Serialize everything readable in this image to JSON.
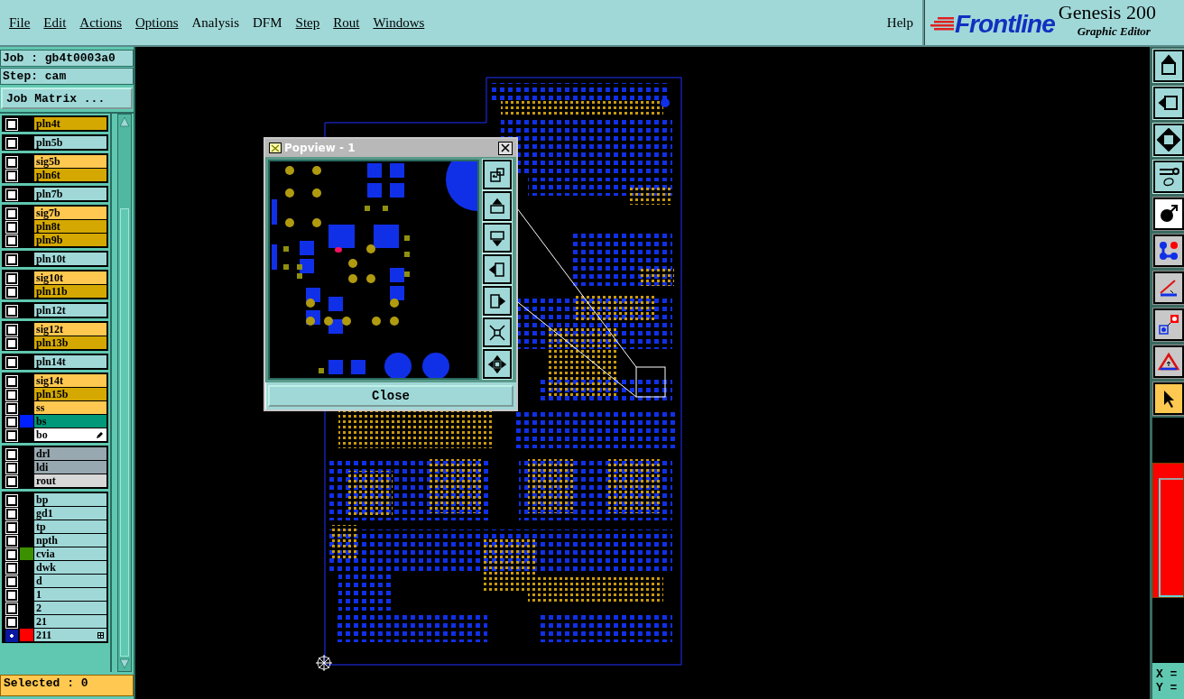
{
  "menu": [
    {
      "label": "File",
      "underlined": true
    },
    {
      "label": "Edit",
      "underlined": true
    },
    {
      "label": "Actions",
      "underlined": true
    },
    {
      "label": "Options",
      "underlined": true
    },
    {
      "label": "Analysis",
      "underlined": false
    },
    {
      "label": "DFM",
      "underlined": false
    },
    {
      "label": "Step",
      "underlined": true
    },
    {
      "label": "Rout",
      "underlined": true
    },
    {
      "label": "Windows",
      "underlined": true
    }
  ],
  "help": {
    "label": "Help"
  },
  "brand": {
    "logo": "Frontline",
    "product": "Genesis 200",
    "subtitle": "Graphic Editor"
  },
  "job_line": "Job : gb4t0003a0",
  "step_line": "Step: cam",
  "job_matrix_button": "Job Matrix ...",
  "layer_groups": [
    {
      "layers": [
        {
          "name": "pln4t",
          "color": "#d4a800",
          "kind": "normal",
          "selected": false
        }
      ]
    },
    {
      "layers": [
        {
          "name": "pln5b",
          "color": "#a0d8d8",
          "kind": "normal",
          "selected": false
        }
      ]
    },
    {
      "layers": [
        {
          "name": "sig5b",
          "color": "#ffc850",
          "kind": "normal",
          "selected": false
        },
        {
          "name": "pln6t",
          "color": "#d4a800",
          "kind": "normal",
          "selected": false
        }
      ]
    },
    {
      "layers": [
        {
          "name": "pln7b",
          "color": "#a0d8d8",
          "kind": "normal",
          "selected": false
        }
      ]
    },
    {
      "layers": [
        {
          "name": "sig7b",
          "color": "#ffc850",
          "kind": "normal",
          "selected": false
        },
        {
          "name": "pln8t",
          "color": "#d4a800",
          "kind": "normal",
          "selected": false
        },
        {
          "name": "pln9b",
          "color": "#d4a800",
          "kind": "normal",
          "selected": false
        }
      ]
    },
    {
      "layers": [
        {
          "name": "pln10t",
          "color": "#a0d8d8",
          "kind": "normal",
          "selected": false
        }
      ]
    },
    {
      "layers": [
        {
          "name": "sig10t",
          "color": "#ffc850",
          "kind": "normal",
          "selected": false
        },
        {
          "name": "pln11b",
          "color": "#d4a800",
          "kind": "normal",
          "selected": false
        }
      ]
    },
    {
      "layers": [
        {
          "name": "pln12t",
          "color": "#a0d8d8",
          "kind": "normal",
          "selected": false
        }
      ]
    },
    {
      "layers": [
        {
          "name": "sig12t",
          "color": "#ffc850",
          "kind": "normal",
          "selected": false
        },
        {
          "name": "pln13b",
          "color": "#d4a800",
          "kind": "normal",
          "selected": false
        }
      ]
    },
    {
      "layers": [
        {
          "name": "pln14t",
          "color": "#a0d8d8",
          "kind": "normal",
          "selected": false
        }
      ]
    },
    {
      "layers": [
        {
          "name": "sig14t",
          "color": "#ffc850",
          "kind": "normal",
          "selected": false
        },
        {
          "name": "pln15b",
          "color": "#d4a800",
          "kind": "normal",
          "selected": false
        },
        {
          "name": "ss",
          "color": "#ffc850",
          "kind": "normal",
          "selected": false
        },
        {
          "name": "bs",
          "color": "#009878",
          "swatch": {
            "color": "#0020ff"
          },
          "kind": "normal",
          "selected": false
        },
        {
          "name": "bo",
          "color": "#ffffff",
          "kind": "work",
          "selected": false
        }
      ]
    },
    {
      "layers": [
        {
          "name": "drl",
          "color": "#98a8b0",
          "kind": "normal",
          "selected": false
        },
        {
          "name": "ldi",
          "color": "#98a8b0",
          "kind": "normal",
          "selected": false
        },
        {
          "name": "rout",
          "color": "#d8d8d8",
          "kind": "normal",
          "selected": false
        }
      ]
    },
    {
      "layers": [
        {
          "name": "bp",
          "color": "#a0d8d8",
          "kind": "normal",
          "selected": false
        },
        {
          "name": "gd1",
          "color": "#a0d8d8",
          "kind": "normal",
          "selected": false
        },
        {
          "name": "tp",
          "color": "#a0d8d8",
          "kind": "normal",
          "selected": false
        },
        {
          "name": "npth",
          "color": "#a0d8d8",
          "kind": "normal",
          "selected": false
        },
        {
          "name": "cvia",
          "color": "#a0d8d8",
          "swatch": {
            "color": "#3c9000"
          },
          "kind": "normal",
          "selected": false
        },
        {
          "name": "dwk",
          "color": "#a0d8d8",
          "kind": "normal",
          "selected": false
        },
        {
          "name": "d",
          "color": "#a0d8d8",
          "kind": "normal",
          "selected": false
        },
        {
          "name": "1",
          "color": "#a0d8d8",
          "kind": "normal",
          "selected": false
        },
        {
          "name": "2",
          "color": "#a0d8d8",
          "kind": "normal",
          "selected": false
        },
        {
          "name": "21",
          "color": "#a0d8d8",
          "kind": "normal",
          "selected": false
        },
        {
          "name": "211",
          "color": "#a0d8d8",
          "swatch": {
            "color": "#ff0000"
          },
          "kind": "affected",
          "selected": true
        }
      ]
    }
  ],
  "selected_status": "Selected : 0",
  "popview": {
    "title": "Popview - 1",
    "close_button": "Close"
  },
  "tools": [
    {
      "kind": "view",
      "selected": false
    },
    {
      "kind": "view",
      "selected": false
    },
    {
      "kind": "view",
      "selected": false
    },
    {
      "kind": "view",
      "selected": false
    },
    {
      "kind": "mode",
      "selected": false
    },
    {
      "kind": "edit",
      "selected": false
    },
    {
      "kind": "edit",
      "selected": false
    },
    {
      "kind": "edit",
      "selected": false
    },
    {
      "kind": "edit",
      "selected": false
    },
    {
      "kind": "edit",
      "selected": true
    }
  ],
  "coordinates": {
    "x_label": "X =",
    "y_label": "Y ="
  }
}
